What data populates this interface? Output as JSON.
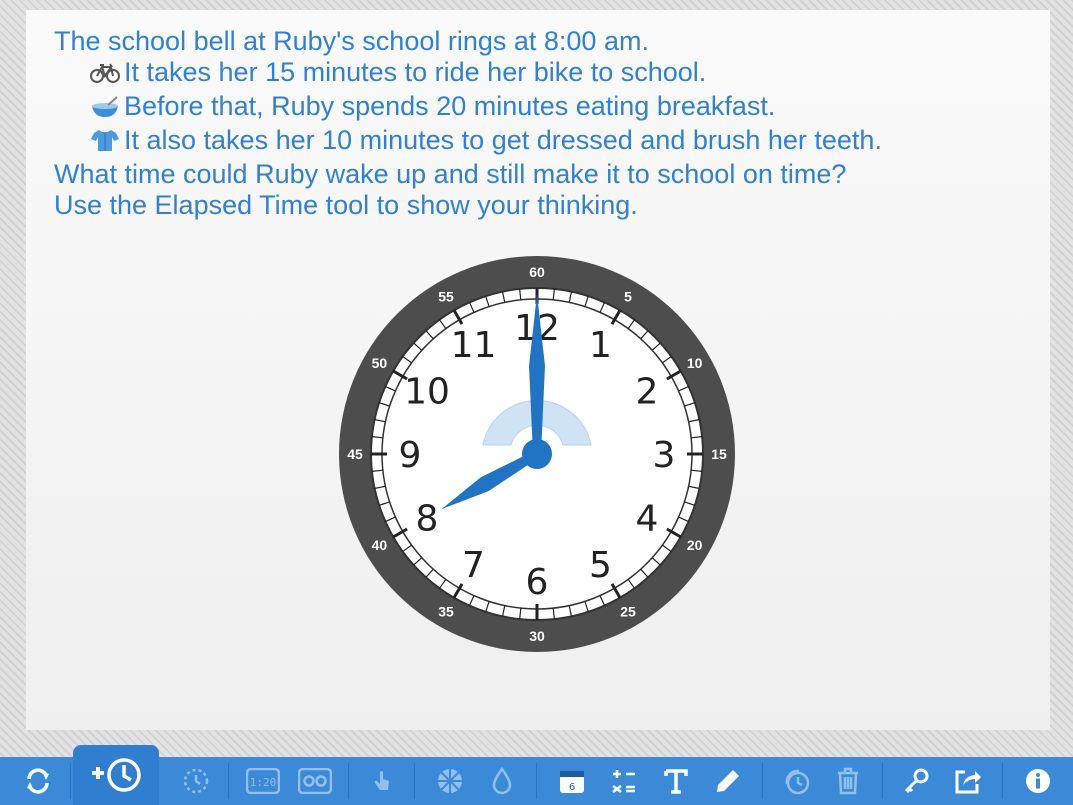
{
  "prompt": {
    "line1": "The school bell at Ruby's school rings at 8:00 am.",
    "bullets": [
      {
        "icon": "bicycle-icon",
        "text": "It takes her 15 minutes to ride her bike to school."
      },
      {
        "icon": "bowl-icon",
        "text": "Before that, Ruby spends 20 minutes eating breakfast."
      },
      {
        "icon": "shirt-icon",
        "text": "It also takes her 10 minutes to get dressed and brush her teeth."
      }
    ],
    "question": "What time could Ruby wake up and still make it to school on time?",
    "instruction": "Use the Elapsed Time tool to show your thinking."
  },
  "clock": {
    "hour_numbers": [
      "12",
      "1",
      "2",
      "3",
      "4",
      "5",
      "6",
      "7",
      "8",
      "9",
      "10",
      "11"
    ],
    "minute_labels": [
      "60",
      "5",
      "10",
      "15",
      "20",
      "25",
      "30",
      "35",
      "40",
      "45",
      "50",
      "55"
    ],
    "time": "8:00",
    "colors": {
      "ring": "#4d4d4d",
      "face": "#ffffff",
      "hands": "#1f74c4"
    }
  },
  "toolbar": {
    "items": [
      {
        "name": "reset-icon"
      },
      {
        "name": "add-clock-icon"
      },
      {
        "name": "elapsed-time-icon"
      },
      {
        "name": "digital-clock-icon"
      },
      {
        "name": "am-pm-icon"
      },
      {
        "name": "touch-icon"
      },
      {
        "name": "fraction-segments-icon"
      },
      {
        "name": "fill-color-icon"
      },
      {
        "name": "calendar-icon"
      },
      {
        "name": "equation-icon"
      },
      {
        "name": "text-icon"
      },
      {
        "name": "pen-icon"
      },
      {
        "name": "duplicate-clock-icon"
      },
      {
        "name": "trash-icon"
      },
      {
        "name": "key-icon"
      },
      {
        "name": "share-icon"
      },
      {
        "name": "info-icon"
      }
    ],
    "digital_label": "1:20",
    "calendar_label": "6"
  }
}
